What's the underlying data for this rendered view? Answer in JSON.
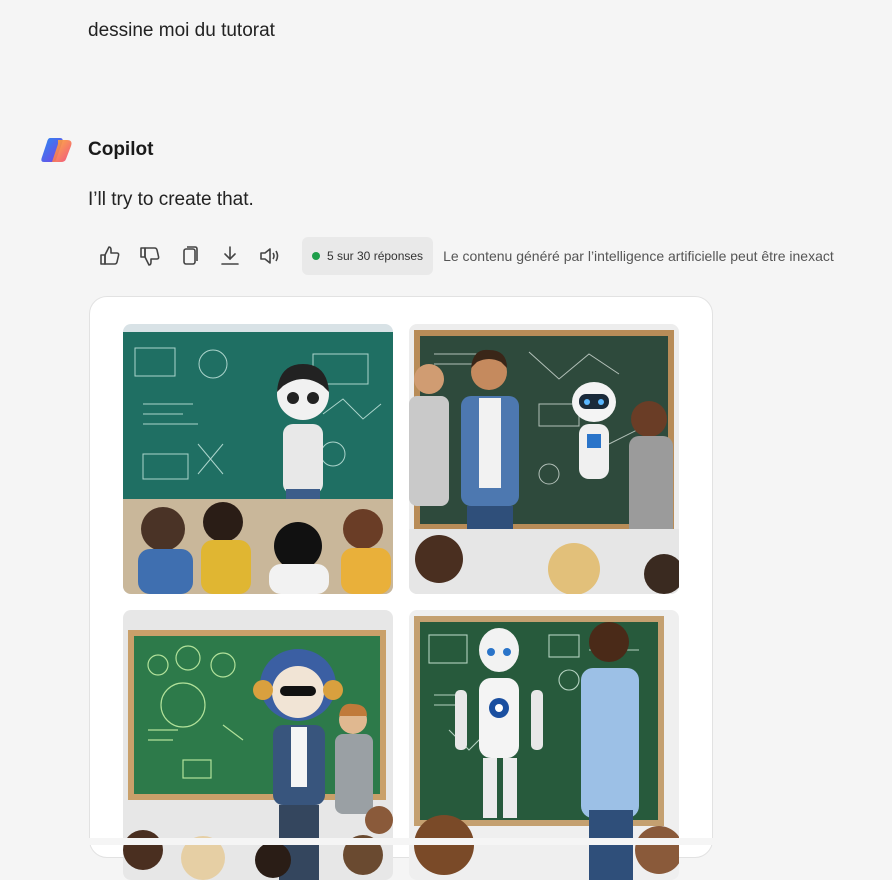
{
  "conversation": {
    "user_message": "dessine moi du tutorat",
    "assistant_name": "Copilot",
    "assistant_message": "I’ll try to create that."
  },
  "actions": {
    "icons": [
      "thumbs-up-icon",
      "thumbs-down-icon",
      "copy-icon",
      "download-icon",
      "speaker-icon"
    ],
    "response_counter": "5 sur 30 réponses",
    "disclaimer": "Le contenu généré par l’intelligence artificielle peut être inexact"
  },
  "colors": {
    "background": "#f5f5f5",
    "counter_dot": "#1e9e4a",
    "chalkboard_teal": "#1f6f63",
    "chalkboard_green": "#2d7a4a"
  },
  "images": [
    {
      "name": "generated-image-1"
    },
    {
      "name": "generated-image-2"
    },
    {
      "name": "generated-image-3"
    },
    {
      "name": "generated-image-4"
    }
  ]
}
